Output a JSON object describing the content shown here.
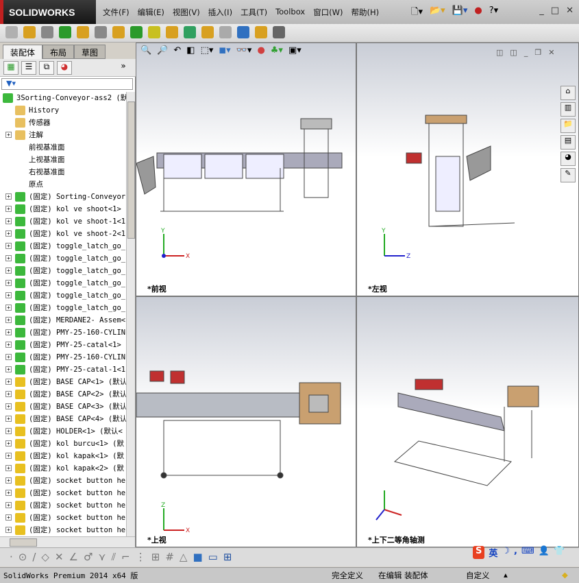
{
  "app": {
    "logo": "SOLIDWORKS",
    "menus": [
      "文件(F)",
      "编辑(E)",
      "视图(V)",
      "插入(I)",
      "工具(T)",
      "Toolbox",
      "窗口(W)",
      "帮助(H)"
    ]
  },
  "panel": {
    "tabs": [
      "装配体",
      "布局",
      "草图"
    ],
    "root": "3Sorting-Conveyor-ass2  (默",
    "fixed_items": [
      {
        "label": "History",
        "icon": "history-folder"
      },
      {
        "label": "传感器",
        "icon": "sensor-folder"
      },
      {
        "label": "注解",
        "icon": "annotation-folder",
        "expand": true
      },
      {
        "label": "前视基准面",
        "icon": "plane"
      },
      {
        "label": "上视基准面",
        "icon": "plane"
      },
      {
        "label": "右视基准面",
        "icon": "plane"
      },
      {
        "label": "原点",
        "icon": "origin"
      }
    ],
    "components": [
      {
        "label": "(固定) Sorting-Conveyor",
        "type": "assembly"
      },
      {
        "label": "(固定) kol ve shoot<1>",
        "type": "assembly"
      },
      {
        "label": "(固定) kol ve shoot-1<1",
        "type": "assembly"
      },
      {
        "label": "(固定) kol ve shoot-2<1",
        "type": "assembly"
      },
      {
        "label": "(固定) toggle_latch_go_",
        "type": "assembly"
      },
      {
        "label": "(固定) toggle_latch_go_",
        "type": "assembly"
      },
      {
        "label": "(固定) toggle_latch_go_",
        "type": "assembly"
      },
      {
        "label": "(固定) toggle_latch_go_",
        "type": "assembly"
      },
      {
        "label": "(固定) toggle_latch_go_",
        "type": "assembly"
      },
      {
        "label": "(固定) toggle_latch_go_",
        "type": "assembly"
      },
      {
        "label": "(固定) MERDANE2- Assem<",
        "type": "assembly"
      },
      {
        "label": "(固定) PMY-25-160-CYLIN",
        "type": "assembly"
      },
      {
        "label": "(固定) PMY-25-catal<1>",
        "type": "assembly"
      },
      {
        "label": "(固定) PMY-25-160-CYLIN",
        "type": "assembly"
      },
      {
        "label": "(固定) PMY-25-catal-1<1",
        "type": "assembly"
      },
      {
        "label": "(固定) BASE CAP<1> (默认",
        "type": "part"
      },
      {
        "label": "(固定) BASE CAP<2> (默认",
        "type": "part"
      },
      {
        "label": "(固定) BASE CAP<3> (默认",
        "type": "part"
      },
      {
        "label": "(固定) BASE CAP<4> (默认",
        "type": "part"
      },
      {
        "label": "(固定) HOLDER<1> (默认<",
        "type": "part"
      },
      {
        "label": "(固定) kol burcu<1> (默",
        "type": "part"
      },
      {
        "label": "(固定) kol kapak<1> (默",
        "type": "part"
      },
      {
        "label": "(固定) kol kapak<2> (默",
        "type": "part"
      },
      {
        "label": "(固定) socket button he",
        "type": "part"
      },
      {
        "label": "(固定) socket button he",
        "type": "part"
      },
      {
        "label": "(固定) socket button he",
        "type": "part"
      },
      {
        "label": "(固定) socket button he",
        "type": "part"
      },
      {
        "label": "(固定) socket button he",
        "type": "part"
      }
    ]
  },
  "viewports": {
    "front": "*前视",
    "left": "*左视",
    "top": "*上视",
    "iso": "*上下二等角轴测"
  },
  "axes": {
    "x": "X",
    "y": "Y",
    "z": "Z"
  },
  "ime": {
    "lang": "英"
  },
  "status": {
    "product": "SolidWorks Premium 2014 x64 版",
    "defined": "完全定义",
    "editing": "在编辑 装配体",
    "units": "自定义"
  },
  "colors": {
    "assembly": "#3cb83c",
    "part": "#e8c020",
    "accent": "#c02020"
  }
}
